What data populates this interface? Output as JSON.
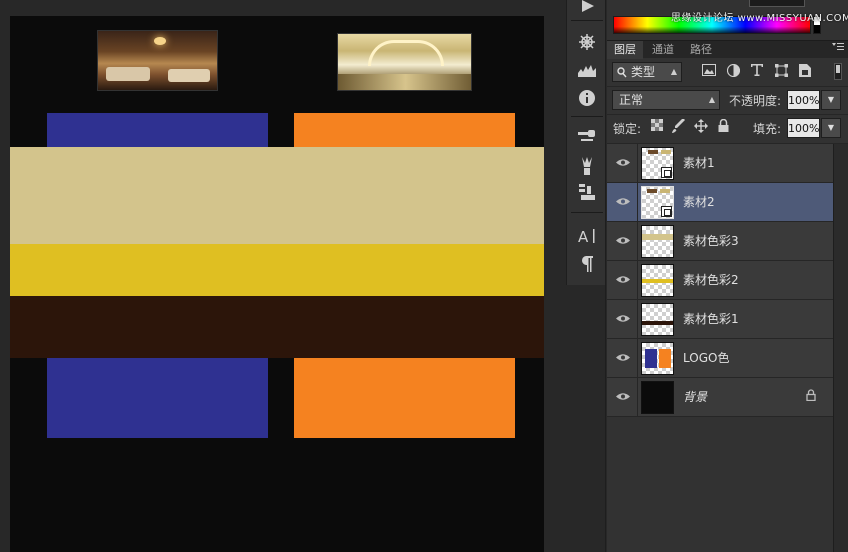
{
  "watermark": "思缘设计论坛 www.MISSYUAN.COM",
  "panel": {
    "tabs": [
      "图层",
      "通道",
      "路径"
    ],
    "active_tab": "图层",
    "filter": {
      "value": "类型",
      "icons": [
        "image-filter-icon",
        "adjustment-filter-icon",
        "type-filter-icon",
        "shape-filter-icon",
        "smart-object-filter-icon"
      ]
    },
    "blend_mode": "正常",
    "opacity_label": "不透明度:",
    "opacity_value": "100%",
    "lock_label": "锁定:",
    "fill_label": "填充:",
    "fill_value": "100%"
  },
  "layers": [
    {
      "name": "素材1",
      "selected": false
    },
    {
      "name": "素材2",
      "selected": true
    },
    {
      "name": "素材色彩3",
      "selected": false
    },
    {
      "name": "素材色彩2",
      "selected": false
    },
    {
      "name": "素材色彩1",
      "selected": false
    },
    {
      "name": "LOGO色",
      "selected": false
    },
    {
      "name": "背景",
      "selected": false,
      "locked": true
    }
  ],
  "colors": {
    "logo_blue": "#2f3191",
    "logo_orange": "#f58220",
    "beige": "#d3c48c",
    "yellow": "#dfbf22",
    "brown": "#2c150a",
    "background": "#0b0b0b",
    "selected_layer": "#4e5a78"
  }
}
